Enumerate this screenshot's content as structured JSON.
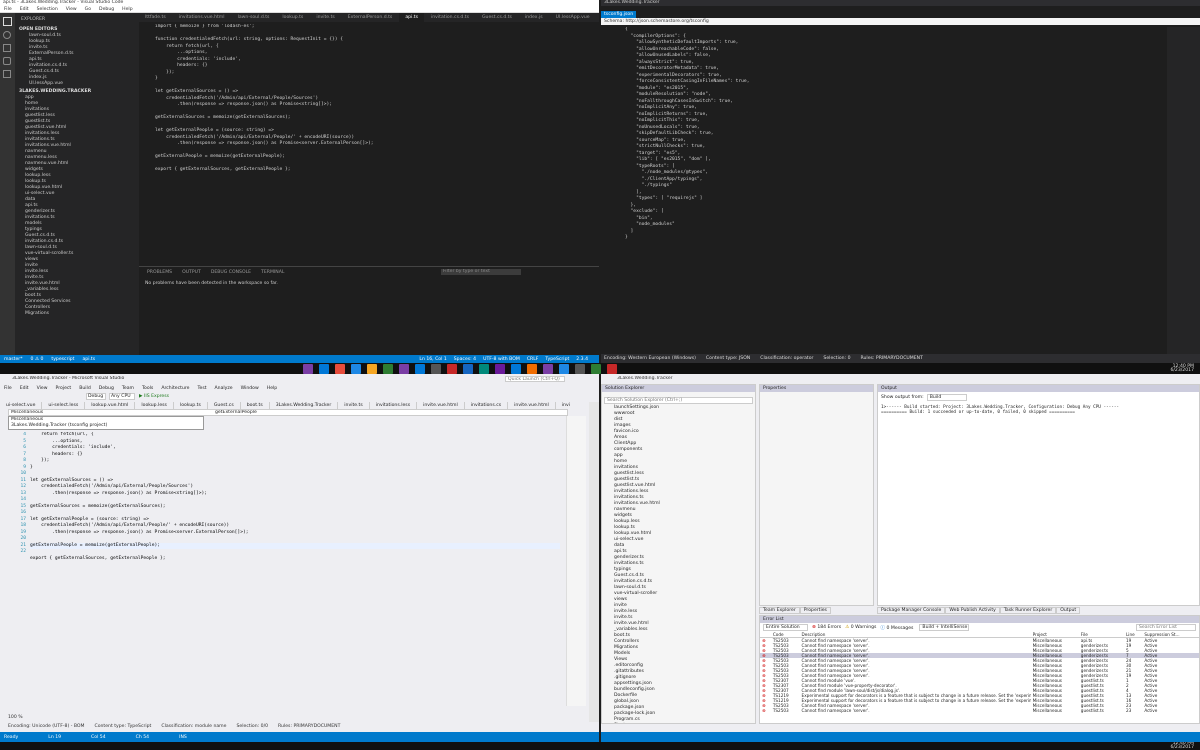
{
  "q1": {
    "title": "api.ts - 3Lakes.Wedding.Tracker - Visual Studio Code",
    "menu": [
      "File",
      "Edit",
      "Selection",
      "View",
      "Go",
      "Debug",
      "Help"
    ],
    "explorer_label": "EXPLORER",
    "open_editors_label": "OPEN EDITORS",
    "open_editors": [
      "lawn-soul.d.ts",
      "lookup.ts",
      "invite.ts",
      "ExternalPerson.d.ts",
      "api.ts",
      "invitation.cs.d.ts",
      "Guest.cs.d.ts",
      "index.js",
      "UI.lessApp.vue"
    ],
    "project_label": "3LAKES.WEDDING.TRACKER",
    "tree": [
      "app",
      "home",
      "invitations",
      "guestlist.less",
      "guestlist.ts",
      "guestlist.vue.html",
      "invitations.less",
      "invitations.ts",
      "invitations.vue.html",
      "navmenu",
      "navmenu.less",
      "navmenu.vue.html",
      "widgets",
      "lookup.less",
      "lookup.ts",
      "lookup.vue.html",
      "ui-select.vue",
      "data",
      "api.ts",
      "genderizer.ts",
      "invitations.ts",
      "models",
      "typings",
      "Guest.cs.d.ts",
      "invitation.cs.d.ts",
      "lawn-soul.d.ts",
      "vue-virtual-scroller.ts",
      "views",
      "invite",
      "invite.less",
      "invite.ts",
      "invite.vue.html",
      "_variables.less",
      "boot.ts",
      "Connected Services",
      "Controllers",
      "Migrations"
    ],
    "tabs": [
      "lttfade.ts",
      "invitations.vue.html",
      "lawn-soul.d.ts",
      "lookup.ts",
      "invite.ts",
      "ExternalPerson.d.ts",
      "api.ts",
      "invitation.cs.d.ts",
      "Guest.cs.d.ts",
      "index.js",
      "UI.lessApp.vue"
    ],
    "code": [
      "import { memoize } from 'lodash-es';",
      "",
      "function credentialedFetch(url: string, options: RequestInit = {}) {",
      "    return fetch(url, {",
      "        ...options,",
      "        credentials: 'include',",
      "        headers: {}",
      "    });",
      "}",
      "",
      "let getExternalSources = () =>",
      "    credentialedFetch('/Admin/api/External/People/Sources')",
      "        .then(response => response.json() as Promise<string[]>);",
      "",
      "getExternalSources = memoize(getExternalSources);",
      "",
      "let getExternalPeople = (source: string) =>",
      "    credentialedFetch('/Admin/api/External/People/' + encodeURI(source))",
      "        .then(response => response.json() as Promise<server.ExternalPerson[]>);",
      "",
      "getExternalPeople = memoize(getExternalPeople);",
      "",
      "export { getExternalSources, getExternalPeople };"
    ],
    "panel_tabs": [
      "PROBLEMS",
      "OUTPUT",
      "DEBUG CONSOLE",
      "TERMINAL"
    ],
    "panel_filter": "Filter by type or text",
    "panel_msg": "No problems have been detected in the workspace so far.",
    "status_left": [
      "master*",
      "0 ⚠ 0",
      "typescript",
      "api.ts"
    ],
    "status_right": [
      "Ln 16, Col 1",
      "Spaces: 4",
      "UTF-8 with BOM",
      "CRLF",
      "TypeScript",
      "2.3.4"
    ]
  },
  "q2": {
    "title": "3Lakes.Wedding.Tracker",
    "tab": "tsconfig.json",
    "schema": "Schema: http://json.schemastore.org/tsconfig",
    "json": [
      "{",
      "  \"compilerOptions\": {",
      "    \"allowSyntheticDefaultImports\": true,",
      "    \"allowUnreachableCode\": false,",
      "    \"allowUnusedLabels\": false,",
      "    \"alwaysStrict\": true,",
      "    \"emitDecoratorMetadata\": true,",
      "    \"experimentalDecorators\": true,",
      "    \"forceConsistentCasingInFileNames\": true,",
      "    \"module\": \"es2015\",",
      "    \"moduleResolution\": \"node\",",
      "    \"noFallthroughCasesInSwitch\": true,",
      "    \"noImplicitAny\": true,",
      "    \"noImplicitReturns\": true,",
      "    \"noImplicitThis\": true,",
      "    \"noUnusedLocals\": true,",
      "    \"skipDefaultLibCheck\": true,",
      "    \"sourceMap\": true,",
      "    \"strictNullChecks\": true,",
      "    \"target\": \"es5\",",
      "    \"lib\": [ \"es2015\", \"dom\" ],",
      "    \"typeRoots\": [",
      "      \"./node_modules/@types\",",
      "      \"./ClientApp/typings\",",
      "      \"./typings\"",
      "    ],",
      "    \"types\": [ \"requirejs\" ]",
      "  },",
      "  \"exclude\": [",
      "    \"bin\",",
      "    \"node_modules\"",
      "  ]",
      "}"
    ],
    "status": [
      "Encoding: Western European (Windows)",
      "Content type: JSON",
      "Classification: operator",
      "Selection: 0",
      "Rules: PRIMARYDOCUMENT"
    ]
  },
  "q3": {
    "title": "3Lakes.Wedding.Tracker - Microsoft Visual Studio",
    "menu": [
      "File",
      "Edit",
      "View",
      "Project",
      "Build",
      "Debug",
      "Team",
      "Tools",
      "Architecture",
      "Test",
      "Analyze",
      "Window",
      "Help"
    ],
    "quick_launch": "Quick Launch (Ctrl+Q)",
    "config": "Debug",
    "platform": "Any CPU",
    "run": "IIS Express",
    "tabs": [
      "ui-select.vue",
      "ui-select.less",
      "lookup.vue.html",
      "lookup.less",
      "lookup.ts",
      "Guest.cs",
      "boot.ts",
      "3Lakes.Wedding.Tracker",
      "invite.ts",
      "invitations.less",
      "invite.vue.html",
      "invitations.cs",
      "invite.vue.html",
      "invitations.vue.html",
      "api.ts"
    ],
    "nav_left": "Miscellaneous",
    "nav_right": "getExternalPeople",
    "dropdown": [
      "Miscellaneous",
      "3Lakes.Wedding.Tracker (tsconfig project)"
    ],
    "code": [
      "    return fetch(url, {",
      "        ...options,",
      "        credentials: 'include',",
      "        headers: {}",
      "    });",
      "}",
      "",
      "let getExternalSources = () =>",
      "    credentialedFetch('/Admin/api/External/People/Sources')",
      "        .then(response => response.json() as Promise<string[]>);",
      "",
      "getExternalSources = memoize(getExternalSources);",
      "",
      "let getExternalPeople = (source: string) =>",
      "    credentialedFetch('/Admin/api/External/People/' + encodeURI(source))",
      "        .then(response => response.json() as Promise<server.ExternalPerson[]>);",
      "",
      "getExternalPeople = memoize(getExternalPeople);",
      "",
      "export { getExternalSources, getExternalPeople };"
    ],
    "line_numbers": [
      "4",
      "5",
      "6",
      "7",
      "8",
      "9",
      "10",
      "11",
      "12",
      "13",
      "14",
      "15",
      "16",
      "17",
      "18",
      "19",
      "20",
      "21",
      "22",
      "23"
    ],
    "zoom": "100 %",
    "status": [
      "Encoding: Unicode (UTF-8) - BOM",
      "Content type: TypeScript",
      "Classification: module name",
      "Selection: 0/0",
      "Rules: PRIMARYDOCUMENT"
    ],
    "statusbar": [
      "Ready",
      "Ln 19",
      "Col 54",
      "Ch 54",
      "INS"
    ]
  },
  "q4": {
    "title": "3Lakes.Wedding.Tracker",
    "se_label": "Solution Explorer",
    "se_search": "Search Solution Explorer (Ctrl+;)",
    "props_label": "Properties",
    "out_label": "Output",
    "out_from": "Show output from:",
    "out_source": "Build",
    "out_lines": [
      "1>------ Build started: Project: 3Lakes.Wedding.Tracker, Configuration: Debug Any CPU ------",
      "========== Build: 1 succeeded or up-to-date, 0 failed, 0 skipped =========="
    ],
    "tree": [
      "launchSettings.json",
      "wwwroot",
      "dist",
      "images",
      "favicon.ico",
      "Areas",
      "ClientApp",
      "components",
      "app",
      "home",
      "invitations",
      "guestlist.less",
      "guestlist.ts",
      "guestlist.vue.html",
      "invitations.less",
      "invitations.ts",
      "invitations.vue.html",
      "navmenu",
      "widgets",
      "lookup.less",
      "lookup.ts",
      "lookup.vue.html",
      "ui-select.vue",
      "data",
      "api.ts",
      "genderizer.ts",
      "invitations.ts",
      "typings",
      "Guest.cs.d.ts",
      "invitation.cs.d.ts",
      "lawn-soul.d.ts",
      "vue-virtual-scroller",
      "views",
      "invite",
      "invite.less",
      "invite.ts",
      "invite.vue.html",
      "_variables.less",
      "boot.ts",
      "Controllers",
      "Migrations",
      "Models",
      "Views",
      ".editorconfig",
      ".gitattributes",
      ".gitignore",
      "appsettings.json",
      "bundleconfig.json",
      "Dockerfile",
      "global.json",
      "package.json",
      "package-lock.json",
      "Program.cs",
      "Startup.cs",
      "tsconfig.json",
      "tslint.json",
      "web.config",
      "webpack.config.js",
      "webpack.config.vendor.js"
    ],
    "se_tabs": [
      "Team Explorer",
      "Properties"
    ],
    "out_tabs": [
      "Package Manager Console",
      "Web Publish Activity",
      "Task Runner Explorer",
      "Output"
    ],
    "err_label": "Error List",
    "err_scope": "Entire Solution",
    "err_errors": "184 Errors",
    "err_warnings": "0 Warnings",
    "err_messages": "0 Messages",
    "err_build": "Build + IntelliSense",
    "err_search": "Search Error List",
    "err_headers": [
      "",
      "Code",
      "Description",
      "Project",
      "File",
      "Line",
      "Suppression St..."
    ],
    "errors": [
      [
        "TS2503",
        "Cannot find namespace 'server'.",
        "Miscellaneous",
        "api.ts",
        "19",
        "Active"
      ],
      [
        "TS2503",
        "Cannot find namespace 'server'.",
        "Miscellaneous",
        "genderizer.ts",
        "19",
        "Active"
      ],
      [
        "TS2503",
        "Cannot find namespace 'server'.",
        "Miscellaneous",
        "genderizer.ts",
        "5",
        "Active"
      ],
      [
        "TS2503",
        "Cannot find namespace 'server'.",
        "Miscellaneous",
        "genderizer.ts",
        "7",
        "Active"
      ],
      [
        "TS2503",
        "Cannot find namespace 'server'.",
        "Miscellaneous",
        "genderizer.ts",
        "24",
        "Active"
      ],
      [
        "TS2503",
        "Cannot find namespace 'server'.",
        "Miscellaneous",
        "genderizer.ts",
        "30",
        "Active"
      ],
      [
        "TS2503",
        "Cannot find namespace 'server'.",
        "Miscellaneous",
        "genderizer.ts",
        "21",
        "Active"
      ],
      [
        "TS2503",
        "Cannot find namespace 'server'.",
        "Miscellaneous",
        "genderizer.ts",
        "19",
        "Active"
      ],
      [
        "TS2307",
        "Cannot find module 'vue'.",
        "Miscellaneous",
        "guestlist.ts",
        "1",
        "Active"
      ],
      [
        "TS2307",
        "Cannot find module 'vue-property-decorator'.",
        "Miscellaneous",
        "guestlist.ts",
        "2",
        "Active"
      ],
      [
        "TS2307",
        "Cannot find module 'lawn-soul/dist/js/dialog.js'.",
        "Miscellaneous",
        "guestlist.ts",
        "4",
        "Active"
      ],
      [
        "TS1219",
        "Experimental support for decorators is a feature that is subject to change in a future release. Set the 'experimentalDecorators' option to remove this warning.",
        "Miscellaneous",
        "guestlist.ts",
        "13",
        "Active"
      ],
      [
        "TS1219",
        "Experimental support for decorators is a feature that is subject to change in a future release. Set the 'experimentalDecorators' option to remove this warning.",
        "Miscellaneous",
        "guestlist.ts",
        "16",
        "Active"
      ],
      [
        "TS2503",
        "Cannot find namespace 'server'.",
        "Miscellaneous",
        "guestlist.ts",
        "23",
        "Active"
      ],
      [
        "TS2503",
        "Cannot find namespace 'server'.",
        "Miscellaneous",
        "guestlist.ts",
        "23",
        "Active"
      ]
    ]
  },
  "taskbar": {
    "time": "12:40 PM",
    "date": "6/23/2017"
  }
}
